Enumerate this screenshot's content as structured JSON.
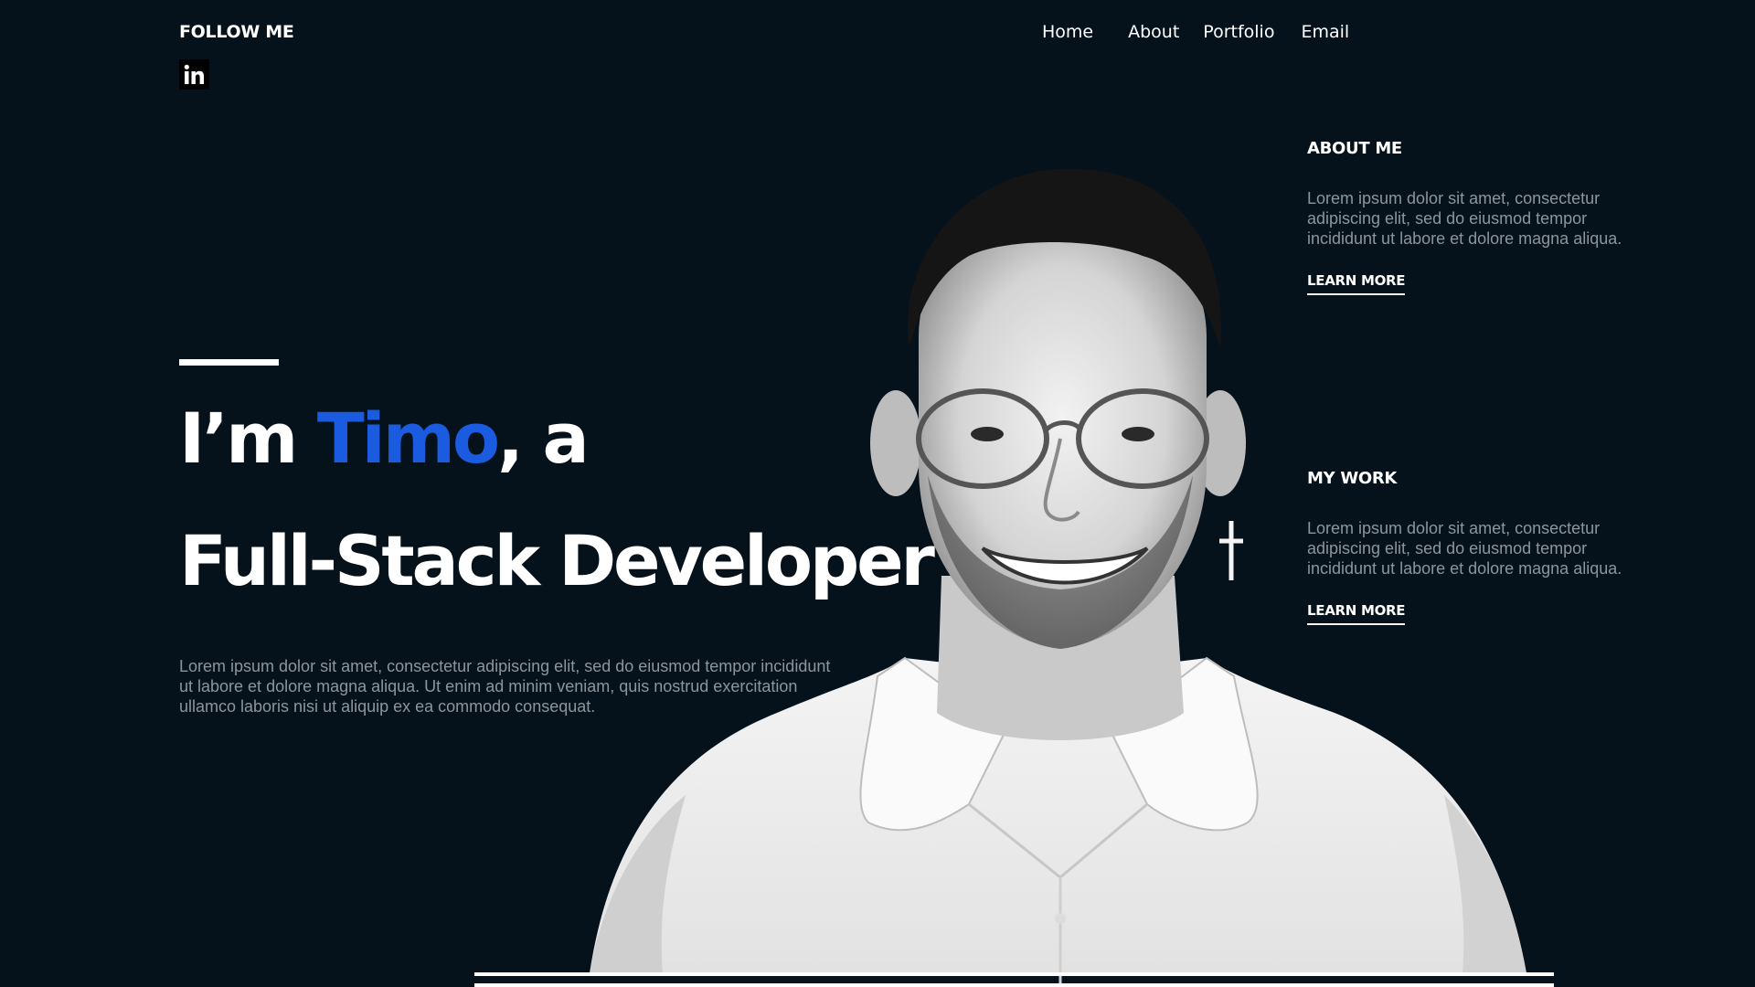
{
  "follow": {
    "title": "FOLLOW ME"
  },
  "social": {
    "icon": "linkedin-icon",
    "glyph": "in"
  },
  "nav": {
    "home": "Home",
    "about": "About",
    "portfolio": "Portfolio",
    "email": "Email"
  },
  "hero": {
    "prefix": "I’m ",
    "name": "Timo",
    "suffix": ", a",
    "line2": "Full-Stack Developer",
    "description": "Lorem ipsum dolor sit amet, consectetur adipiscing elit, sed do eiusmod tempor incididunt ut labore et dolore magna aliqua. Ut enim ad minim veniam, quis nostrud exercitation ullamco laboris nisi ut aliquip ex ea commodo consequat."
  },
  "about_me": {
    "title": "ABOUT ME",
    "text": "Lorem ipsum dolor sit amet, consectetur adipiscing elit, sed do eiusmod tempor incididunt ut labore et dolore magna aliqua.",
    "link": "LEARN MORE"
  },
  "my_work": {
    "title": "MY WORK",
    "text": "Lorem ipsum dolor sit amet, consectetur adipiscing elit, sed do eiusmod tempor incididunt ut labore et dolore magna aliqua.",
    "link": "LEARN MORE"
  },
  "colors": {
    "background": "#06121b",
    "accent": "#1a5be0",
    "muted_text": "#8d959c"
  }
}
